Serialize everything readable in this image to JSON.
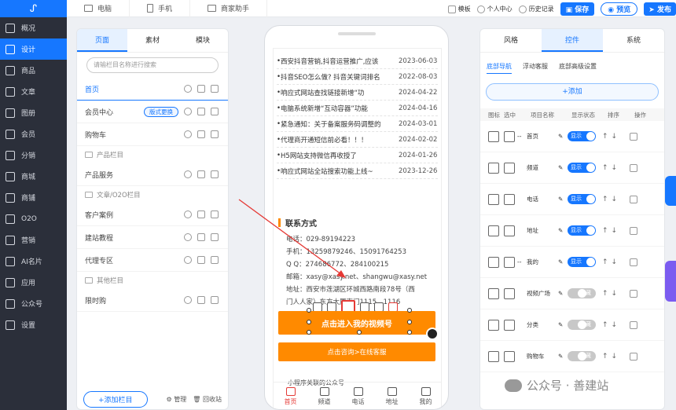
{
  "sidebar": {
    "items": [
      {
        "label": "概况",
        "icon": "chart-icon"
      },
      {
        "label": "设计",
        "icon": "palette-icon",
        "active": true
      },
      {
        "label": "商品",
        "icon": "box-icon"
      },
      {
        "label": "文章",
        "icon": "document-icon"
      },
      {
        "label": "图册",
        "icon": "image-icon"
      },
      {
        "label": "会员",
        "icon": "user-icon"
      },
      {
        "label": "分销",
        "icon": "share-icon"
      },
      {
        "label": "商城",
        "icon": "shop-icon"
      },
      {
        "label": "商铺",
        "icon": "store-icon"
      },
      {
        "label": "O2O",
        "icon": "o2o-icon"
      },
      {
        "label": "营销",
        "icon": "marketing-icon"
      },
      {
        "label": "AI名片",
        "icon": "card-icon"
      },
      {
        "label": "应用",
        "icon": "grid-icon"
      },
      {
        "label": "公众号",
        "icon": "wechat-icon"
      },
      {
        "label": "设置",
        "icon": "gear-icon"
      }
    ]
  },
  "topbar": {
    "tabs": [
      "电脑",
      "手机",
      "商家助手"
    ],
    "template": "模板",
    "user_center": "个人中心",
    "history": "历史记录",
    "save": "保存",
    "preview": "预览",
    "publish": "发布"
  },
  "left_panel": {
    "tabs": [
      "页面",
      "素材",
      "模块"
    ],
    "search_placeholder": "请输栏目名称进行搜索",
    "rows": [
      {
        "label": "首页",
        "kind": "page"
      },
      {
        "label": "会员中心",
        "kind": "page",
        "badge": "版式更换"
      },
      {
        "label": "购物车",
        "kind": "page"
      },
      {
        "label": "产品栏目",
        "kind": "group"
      },
      {
        "label": "产品服务",
        "kind": "page"
      },
      {
        "label": "文章/O2O栏目",
        "kind": "group"
      },
      {
        "label": "客户案例",
        "kind": "page"
      },
      {
        "label": "建站教程",
        "kind": "page"
      },
      {
        "label": "代理专区",
        "kind": "page"
      },
      {
        "label": "其他栏目",
        "kind": "group"
      },
      {
        "label": "限时购",
        "kind": "page"
      }
    ],
    "add_column": "+添加栏目",
    "manage": "管理",
    "recycle": "回收站"
  },
  "phone": {
    "news": [
      {
        "title": "西安抖音营销,抖音运营推广,应该",
        "date": "2023-06-03"
      },
      {
        "title": "抖音SEO怎么做? 抖音关键词排名",
        "date": "2022-08-03"
      },
      {
        "title": "响应式网站查找链接新增“功",
        "date": "2024-04-22"
      },
      {
        "title": "电脑系统新增“互动容器”功能",
        "date": "2024-04-16"
      },
      {
        "title": "紧急通知：关于备案服务码调整的",
        "date": "2024-03-01"
      },
      {
        "title": "代理商开通短信前必看！！！",
        "date": "2024-02-02"
      },
      {
        "title": "H5网站支持微信再收授了",
        "date": "2024-01-26"
      },
      {
        "title": "响应式网站全站搜索功能上线~",
        "date": "2023-12-26"
      }
    ],
    "contact_title": "联系方式",
    "contact_lines": [
      "电话：029-89194223",
      "手机：13259879246、15091764253",
      "Q Q：274686772、284100215",
      "邮箱：xasy@xasy.net、shangwu@xasy.net",
      "地址：西安市莲湖区环城西路南段78号（西",
      "门人人家）东方大厦南门1115、1116"
    ],
    "video_button": "点击进入我的视频号",
    "consult_button": "点击咨询>在线客服",
    "wechat_related": "小程序关联的公众号",
    "bottom_nav": [
      "首页",
      "频道",
      "电话",
      "地址",
      "我的"
    ]
  },
  "right_panel": {
    "tabs": [
      "风格",
      "控件",
      "系统"
    ],
    "subtabs": [
      "底部导航",
      "浮动客服",
      "底部高级设置"
    ],
    "add": "+添加",
    "headers": [
      "图标",
      "选中",
      "项目名称",
      "显示状态",
      "排序",
      "操作"
    ],
    "rows": [
      {
        "name": "首页",
        "status": "显示",
        "on": true
      },
      {
        "name": "频道",
        "status": "显示",
        "on": true
      },
      {
        "name": "电话",
        "status": "显示",
        "on": true
      },
      {
        "name": "地址",
        "status": "显示",
        "on": true
      },
      {
        "name": "我的",
        "status": "显示",
        "on": true
      },
      {
        "name": "视频广场",
        "status": "隐藏",
        "on": false
      },
      {
        "name": "分类",
        "status": "隐藏",
        "on": false
      },
      {
        "name": "购物车",
        "status": "隐藏",
        "on": false
      }
    ],
    "row_extra": [
      "--",
      "",
      "",
      "",
      "--",
      "",
      "",
      ""
    ]
  },
  "watermark": "公众号 · 善建站",
  "colors": {
    "primary": "#1677ff",
    "accent": "#ff8a00",
    "sidebar": "#2b2f3a"
  }
}
